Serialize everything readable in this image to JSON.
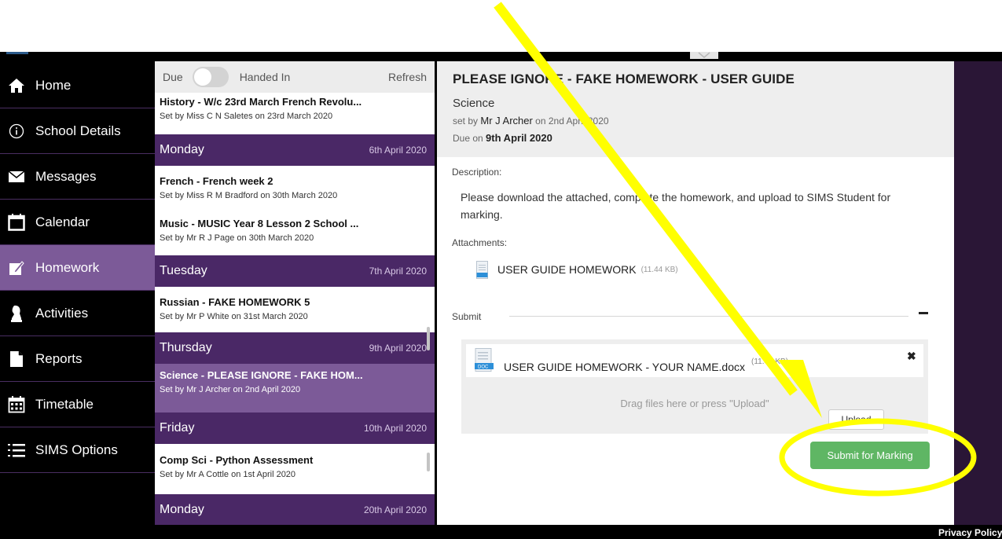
{
  "sidebar": {
    "items": [
      {
        "label": "Home",
        "icon": "home-icon"
      },
      {
        "label": "School Details",
        "icon": "info-icon"
      },
      {
        "label": "Messages",
        "icon": "envelope-icon"
      },
      {
        "label": "Calendar",
        "icon": "calendar-icon"
      },
      {
        "label": "Homework",
        "icon": "edit-icon",
        "active": true
      },
      {
        "label": "Activities",
        "icon": "chess-piece-icon"
      },
      {
        "label": "Reports",
        "icon": "document-icon"
      },
      {
        "label": "Timetable",
        "icon": "timetable-icon"
      },
      {
        "label": "SIMS Options",
        "icon": "list-icon"
      }
    ]
  },
  "list": {
    "toolbar": {
      "due_label": "Due",
      "handed_in_label": "Handed In",
      "refresh_label": "Refresh"
    },
    "top_item": {
      "title": "History - W/c 23rd March French Revolu...",
      "subtitle": "Set by Miss C N Saletes on 23rd March 2020"
    },
    "groups": [
      {
        "day": "Monday",
        "date": "6th April 2020",
        "items": [
          {
            "title": "French - French week 2",
            "subtitle": "Set by Miss R M Bradford on 30th March 2020"
          },
          {
            "title": "Music - MUSIC Year 8 Lesson 2 School ...",
            "subtitle": "Set by Mr R J Page on 30th March 2020"
          }
        ]
      },
      {
        "day": "Tuesday",
        "date": "7th April 2020",
        "items": [
          {
            "title": "Russian - FAKE HOMEWORK 5",
            "subtitle": "Set by Mr P White on 31st March 2020"
          }
        ]
      },
      {
        "day": "Thursday",
        "date": "9th April 2020",
        "items": [
          {
            "title": "Science - PLEASE IGNORE - FAKE HOM...",
            "subtitle": "Set by Mr J Archer on 2nd April 2020",
            "selected": true
          }
        ]
      },
      {
        "day": "Friday",
        "date": "10th April 2020",
        "items": [
          {
            "title": "Comp Sci - Python Assessment",
            "subtitle": "Set by Mr A Cottle on 1st April 2020"
          }
        ]
      },
      {
        "day": "Monday",
        "date": "20th April 2020",
        "items": []
      }
    ]
  },
  "detail": {
    "title": "PLEASE IGNORE - FAKE HOMEWORK - USER GUIDE",
    "subject": "Science",
    "set_by_prefix": "set by",
    "set_by_name": "Mr J Archer",
    "set_on_text": "on 2nd April 2020",
    "due_prefix": "Due on",
    "due_date": "9th April 2020",
    "description_label": "Description:",
    "description": "Please download the attached, complete the homework, and upload to SIMS Student for marking.",
    "attachments_label": "Attachments:",
    "attachment": {
      "name": "USER GUIDE HOMEWORK",
      "size": "(11.44 KB)",
      "icon": "doc-file-icon"
    },
    "submit_label": "Submit",
    "uploaded_file": {
      "name": "USER GUIDE HOMEWORK - YOUR NAME.docx",
      "size": "(11.44 KB)",
      "remove_symbol": "✖"
    },
    "drag_text": "Drag files here or press \"Upload\"",
    "upload_button": "Upload",
    "submit_button": "Submit for Marking"
  },
  "footer": {
    "privacy": "Privacy Policy"
  },
  "colors": {
    "sidebar_bg": "#000000",
    "active_purple": "#7c5a98",
    "day_header": "#4a2866",
    "submit_green": "#5fb664",
    "annotation_yellow": "#ffff00"
  }
}
